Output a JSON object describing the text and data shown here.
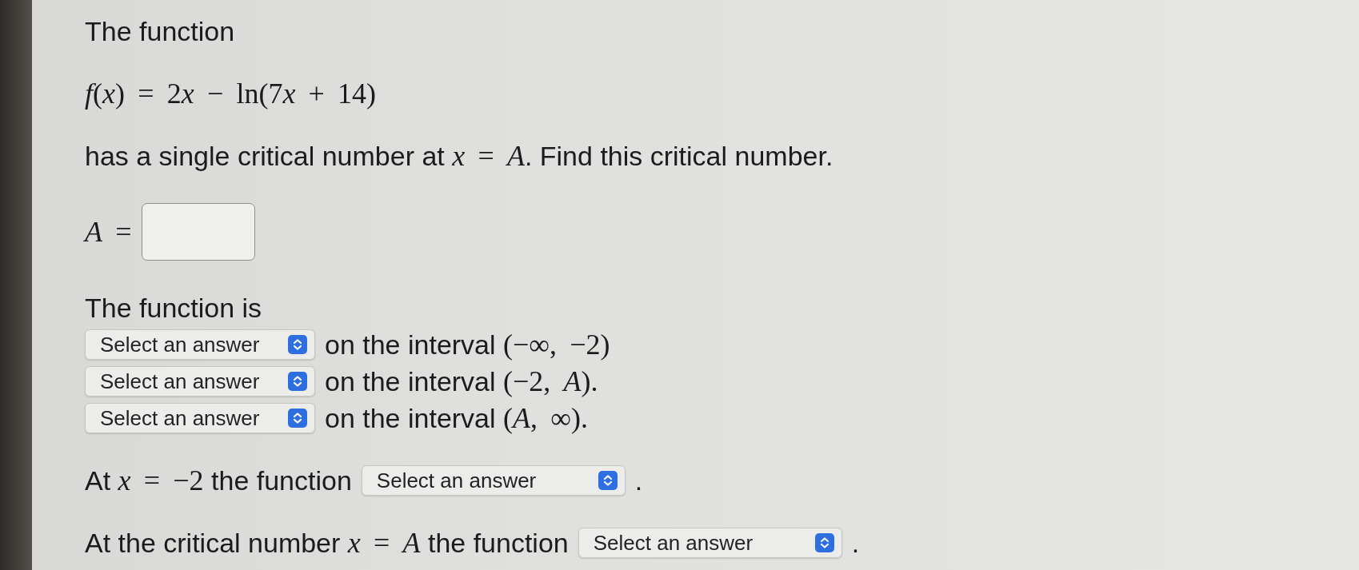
{
  "blocks": [
    {
      "lines": [
        {
          "parts": [
            {
              "kind": "text",
              "text": "The function"
            }
          ]
        }
      ]
    },
    {
      "lines": [
        {
          "parts": [
            {
              "kind": "math",
              "text": "*f*(*x*) = 2"
            },
            {
              "kind": "math",
              "text": "*x*"
            },
            {
              "kind": "math",
              "text": " − ln(7"
            },
            {
              "kind": "math",
              "text": "*x*"
            },
            {
              "kind": "math",
              "text": " + 14)"
            }
          ]
        }
      ]
    },
    {
      "lines": [
        {
          "parts": [
            {
              "kind": "text",
              "text": "has a single critical number at "
            },
            {
              "kind": "math",
              "text": "*x* = *A*"
            },
            {
              "kind": "text",
              "text": ". Find this critical number."
            }
          ]
        }
      ]
    },
    {
      "lines": [
        {
          "parts": [
            {
              "kind": "math",
              "text": "*A* ="
            },
            {
              "kind": "input"
            }
          ]
        }
      ]
    },
    {
      "lines": [
        {
          "parts": [
            {
              "kind": "text",
              "text": "The function is"
            }
          ]
        },
        {
          "parts": [
            {
              "kind": "select",
              "placeholder": "Select an answer"
            },
            {
              "kind": "text",
              "text": "on the interval "
            },
            {
              "kind": "math",
              "text": "(−∞, −2)"
            }
          ]
        },
        {
          "parts": [
            {
              "kind": "select",
              "placeholder": "Select an answer"
            },
            {
              "kind": "text",
              "text": "on the interval "
            },
            {
              "kind": "math",
              "text": "(−2, *A*)."
            }
          ]
        },
        {
          "parts": [
            {
              "kind": "select",
              "placeholder": "Select an answer"
            },
            {
              "kind": "text",
              "text": "on the interval "
            },
            {
              "kind": "math",
              "text": "(*A*, ∞)."
            }
          ]
        }
      ]
    },
    {
      "lines": [
        {
          "parts": [
            {
              "kind": "text",
              "text": "At "
            },
            {
              "kind": "math",
              "text": "*x* = −2"
            },
            {
              "kind": "text",
              "text": " the function"
            },
            {
              "kind": "select",
              "placeholder": "Select an answer"
            },
            {
              "kind": "text",
              "text": "."
            }
          ]
        }
      ]
    },
    {
      "lines": [
        {
          "parts": [
            {
              "kind": "text",
              "text": "At the critical number "
            },
            {
              "kind": "math",
              "text": "*x* = *A*"
            },
            {
              "kind": "text",
              "text": " the function"
            },
            {
              "kind": "select",
              "placeholder": "Select an answer"
            },
            {
              "kind": "text",
              "text": "."
            }
          ]
        }
      ]
    }
  ]
}
